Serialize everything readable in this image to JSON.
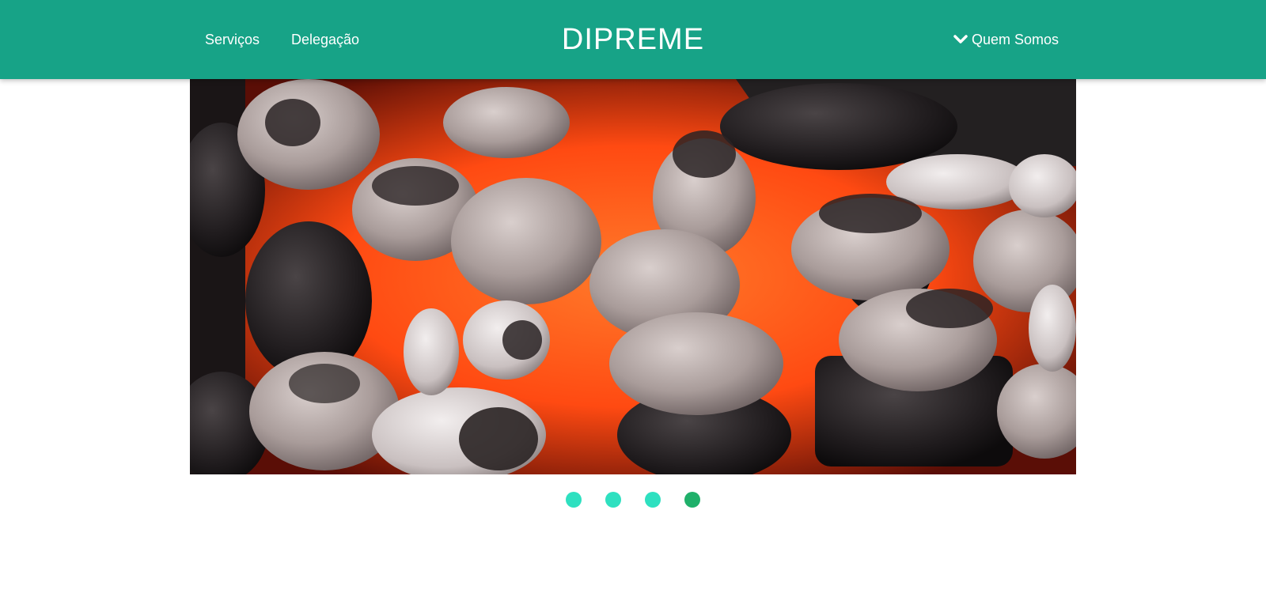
{
  "header": {
    "brand": "DIPREME",
    "nav_left": [
      {
        "label": "Serviços"
      },
      {
        "label": "Delegação"
      }
    ],
    "about_menu": {
      "label": "Quem Somos",
      "icon": "chevron-down-icon"
    }
  },
  "slider": {
    "image_description_icon": "charcoal-embers-image",
    "dots": [
      {
        "active": false
      },
      {
        "active": false
      },
      {
        "active": false
      },
      {
        "active": true
      }
    ]
  },
  "colors": {
    "header_bg": "#17a387",
    "dot_inactive": "#2ee0c0",
    "dot_active": "#1fb06a"
  }
}
